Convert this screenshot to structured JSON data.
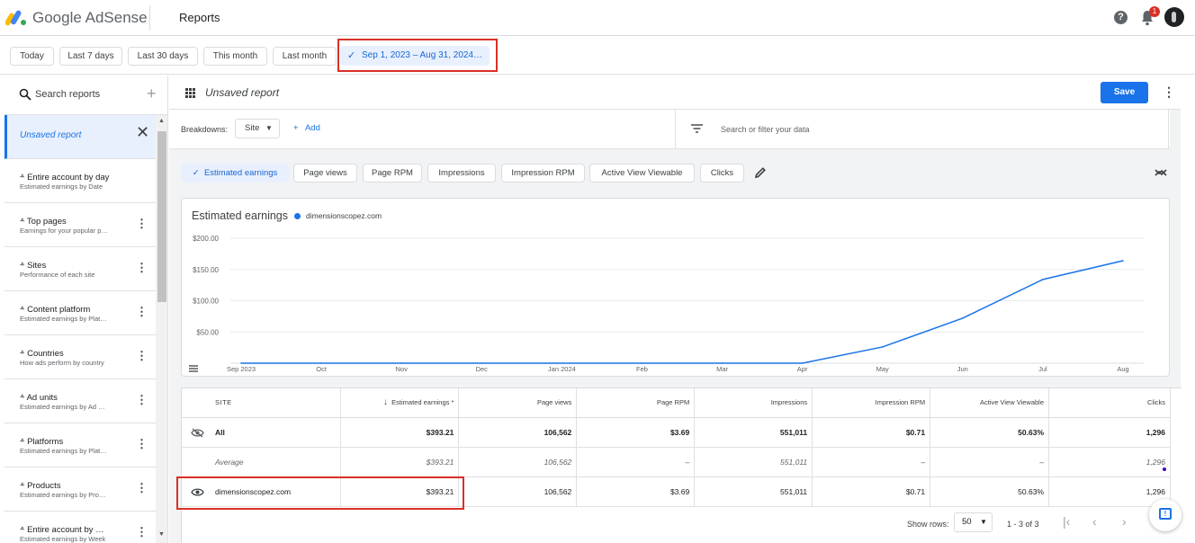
{
  "app": {
    "brand": "Google AdSense",
    "page_title": "Reports"
  },
  "header": {
    "help_glyph": "?",
    "notification_count": "1"
  },
  "date_ranges": {
    "today": "Today",
    "last7": "Last 7 days",
    "last30": "Last 30 days",
    "this_month": "This month",
    "last_month": "Last month",
    "custom": "Sep 1, 2023 – Aug 31, 2024…"
  },
  "sidebar": {
    "search_placeholder": "Search reports",
    "active_report": "Unsaved report",
    "items": [
      {
        "title": "Entire account by day",
        "subtitle": "Estimated earnings by Date"
      },
      {
        "title": "Top pages",
        "subtitle": "Earnings for your popular p…"
      },
      {
        "title": "Sites",
        "subtitle": "Performance of each site"
      },
      {
        "title": "Content platform",
        "subtitle": "Estimated earnings by Plat…"
      },
      {
        "title": "Countries",
        "subtitle": "How ads perform by country"
      },
      {
        "title": "Ad units",
        "subtitle": "Estimated earnings by Ad …"
      },
      {
        "title": "Platforms",
        "subtitle": "Estimated earnings by Plat…"
      },
      {
        "title": "Products",
        "subtitle": "Estimated earnings by Pro…"
      },
      {
        "title": "Entire account by …",
        "subtitle": "Estimated earnings by Week"
      }
    ]
  },
  "report": {
    "title": "Unsaved report",
    "save_label": "Save",
    "breakdowns_label": "Breakdowns:",
    "breakdown_value": "Site",
    "add_label": "Add",
    "filter_placeholder": "Search or filter your data",
    "metrics": [
      "Estimated earnings",
      "Page views",
      "Page RPM",
      "Impressions",
      "Impression RPM",
      "Active View Viewable",
      "Clicks"
    ],
    "selected_metric": "Estimated earnings"
  },
  "chart_data": {
    "type": "line",
    "title": "Estimated earnings",
    "series": [
      {
        "name": "dimensionscopez.com",
        "color": "#1a73e8",
        "values": [
          0,
          0,
          0,
          0,
          0,
          0,
          0,
          0,
          26,
          72,
          134,
          164
        ]
      }
    ],
    "categories": [
      "Sep 2023",
      "Oct",
      "Nov",
      "Dec",
      "Jan 2024",
      "Feb",
      "Mar",
      "Apr",
      "May",
      "Jun",
      "Jul",
      "Aug"
    ],
    "yticks": [
      "$200.00",
      "$150.00",
      "$100.00",
      "$50.00"
    ],
    "ytick_values": [
      200,
      150,
      100,
      50
    ],
    "ylim": [
      0,
      200
    ],
    "grid": true,
    "legend": "top-left"
  },
  "table": {
    "columns": [
      "SITE",
      "Estimated earnings *",
      "Page views",
      "Page RPM",
      "Impressions",
      "Impression RPM",
      "Active View Viewable",
      "Clicks"
    ],
    "rows": [
      {
        "site": "All",
        "values": [
          "$393.21",
          "106,562",
          "$3.69",
          "551,011",
          "$0.71",
          "50.63%",
          "1,296"
        ]
      },
      {
        "site": "Average",
        "values": [
          "$393.21",
          "106,562",
          "–",
          "551,011",
          "–",
          "–",
          "1,296"
        ]
      },
      {
        "site": "dimensionscopez.com",
        "values": [
          "$393.21",
          "106,562",
          "$3.69",
          "551,011",
          "$0.71",
          "50.63%",
          "1,296"
        ]
      }
    ]
  },
  "pager": {
    "show_rows_label": "Show rows:",
    "rows_value": "50",
    "range": "1 - 3 of 3"
  }
}
